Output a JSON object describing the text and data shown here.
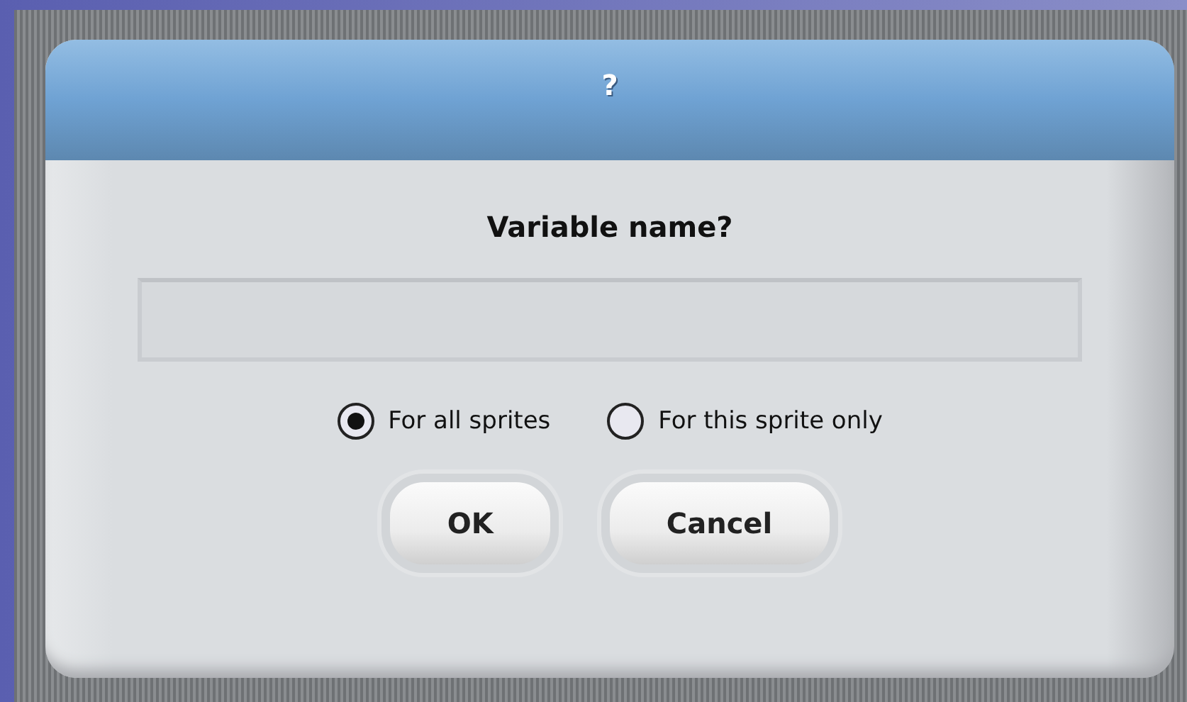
{
  "dialog": {
    "title": "?",
    "prompt": "Variable name?",
    "options": [
      {
        "label": "For all sprites",
        "selected": true
      },
      {
        "label": "For this sprite only",
        "selected": false
      }
    ],
    "buttons": [
      "OK",
      "Cancel"
    ]
  }
}
